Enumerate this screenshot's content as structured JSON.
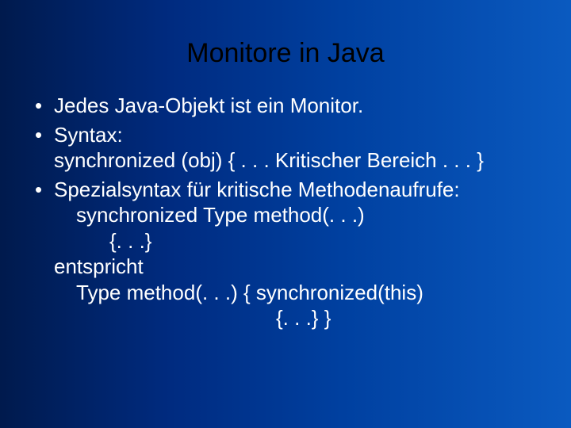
{
  "title": "Monitore in Java",
  "bullets": {
    "b1": "Jedes Java-Objekt ist ein Monitor.",
    "b2": {
      "l1": "Syntax:",
      "l2": "synchronized (obj) { . . . Kritischer Bereich . . . }"
    },
    "b3": {
      "l1": "Spezialsyntax für kritische Methodenaufrufe:",
      "l2": "synchronized Type method(. . .)",
      "l3": "{. . .}",
      "l4": "entspricht",
      "l5": "Type method(. . .)   { synchronized(this)",
      "l6": "{. . .} }"
    }
  }
}
